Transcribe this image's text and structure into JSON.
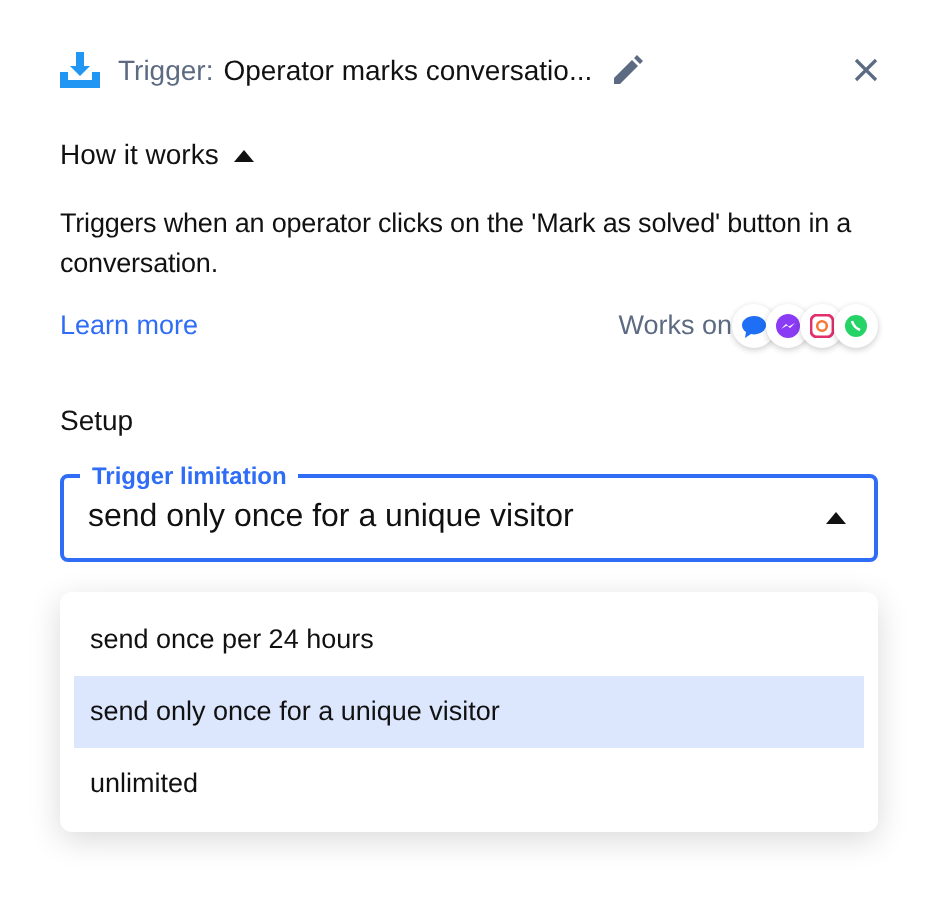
{
  "header": {
    "label": "Trigger:",
    "title": "Operator marks conversatio..."
  },
  "how_it_works": {
    "title": "How it works",
    "expanded": true,
    "description": "Triggers when an operator clicks on the 'Mark as solved' button in a conversation.",
    "link": "Learn more",
    "works_on": "Works on"
  },
  "setup": {
    "title": "Setup",
    "field": {
      "label": "Trigger limitation",
      "value": "send only once for a unique visitor",
      "open": true
    },
    "options": [
      {
        "label": "send once per 24 hours",
        "selected": false
      },
      {
        "label": "send only once for a unique visitor",
        "selected": true
      },
      {
        "label": "unlimited",
        "selected": false
      }
    ]
  }
}
